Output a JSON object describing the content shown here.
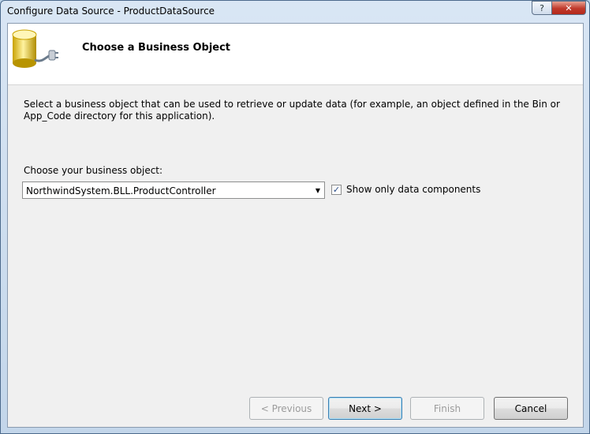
{
  "window": {
    "title": "Configure Data Source - ProductDataSource",
    "help_glyph": "?",
    "close_glyph": "✕"
  },
  "header": {
    "title": "Choose a Business Object"
  },
  "main": {
    "description": "Select a business object that can be used to retrieve or update data (for example, an object defined in the Bin or App_Code directory for this application).",
    "choose_label": "Choose your business object:",
    "business_object": {
      "selected_value": "NorthwindSystem.BLL.ProductController"
    },
    "show_only_data_components": {
      "label": "Show only data components",
      "checked": true
    }
  },
  "footer": {
    "previous_label": "< Previous",
    "next_label": "Next >",
    "finish_label": "Finish",
    "cancel_label": "Cancel"
  },
  "icons": {
    "header_icon": "database-plug-icon",
    "dropdown_icon": "chevron-down-icon",
    "check_icon": "check-icon"
  }
}
